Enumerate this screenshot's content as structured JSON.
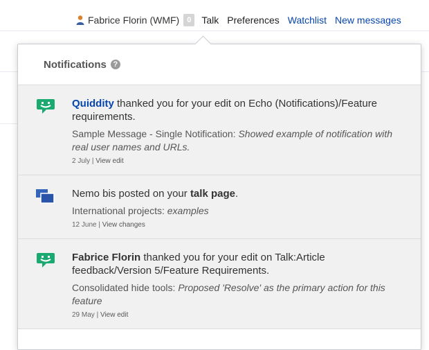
{
  "topbar": {
    "user_name": "Fabrice Florin (WMF)",
    "notification_count": "0",
    "links": {
      "talk": "Talk",
      "preferences": "Preferences",
      "watchlist": "Watchlist",
      "new_messages": "New messages"
    }
  },
  "panel": {
    "title": "Notifications",
    "help_glyph": "?",
    "items": [
      {
        "icon": "thanks-icon",
        "agent": "Quiddity",
        "title_rest": " thanked you for your edit on Echo (Notifications)/Feature requirements.",
        "body_prefix": "Sample Message - Single Notification: ",
        "body_italic": "Showed example of notification with real user names and URLs.",
        "date": "2 July",
        "separator": " | ",
        "action": "View edit"
      },
      {
        "icon": "talk-page-icon",
        "agent": "Nemo bis",
        "title_mid": " posted on your ",
        "title_bold": "talk page",
        "title_end": ".",
        "body_prefix": "International projects: ",
        "body_italic": "examples",
        "date": "12 June",
        "separator": " | ",
        "action": "View changes"
      },
      {
        "icon": "thanks-icon",
        "agent": "Fabrice Florin",
        "title_rest": " thanked you for your edit on Talk:Article feedback/Version 5/Feature Requirements.",
        "body_prefix": "Consolidated hide tools: ",
        "body_italic": "Proposed 'Resolve' as the primary action for this feature",
        "date": "29 May",
        "separator": " | ",
        "action": "View edit"
      }
    ]
  },
  "colors": {
    "link": "#0645ad",
    "thanks_icon": "#1aaa6f",
    "talk_icon": "#3366bb",
    "item_background": "#f1f1f1"
  }
}
